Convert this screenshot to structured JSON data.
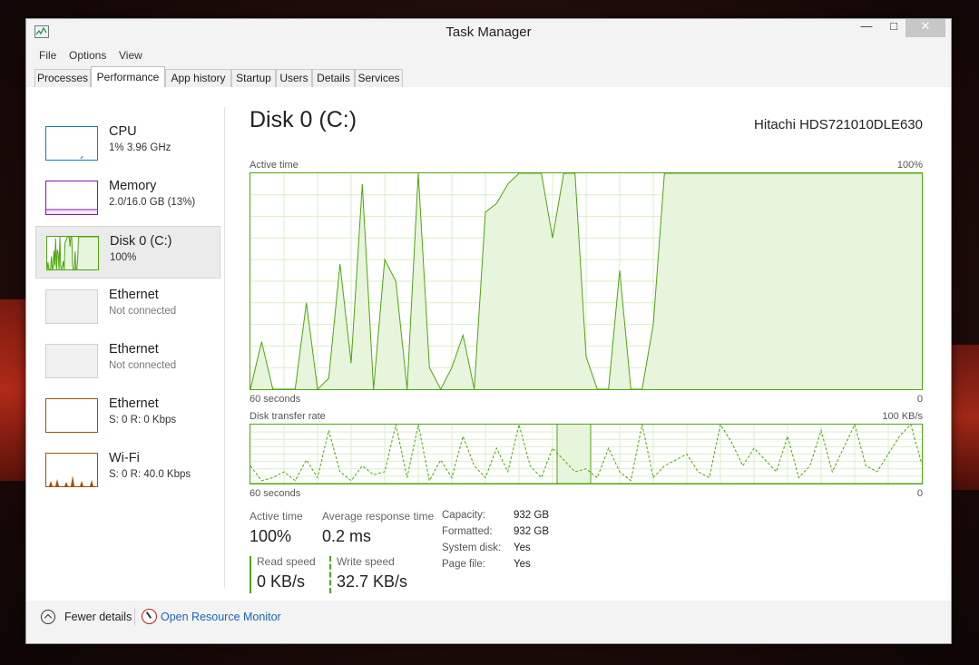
{
  "window": {
    "title": "Task Manager",
    "minimize": "—",
    "maximize": "□",
    "close": "✕"
  },
  "menu": [
    "File",
    "Options",
    "View"
  ],
  "tabs": [
    "Processes",
    "Performance",
    "App history",
    "Startup",
    "Users",
    "Details",
    "Services"
  ],
  "active_tab": "Performance",
  "sidebar": {
    "items": [
      {
        "name": "CPU",
        "sub": "1% 3.96 GHz",
        "kind": "cpu",
        "color": "#117dbb"
      },
      {
        "name": "Memory",
        "sub": "2.0/16.0 GB (13%)",
        "kind": "mem",
        "color": "#8b12ae"
      },
      {
        "name": "Disk 0 (C:)",
        "sub": "100%",
        "kind": "disk",
        "color": "#4da60c",
        "selected": true
      },
      {
        "name": "Ethernet",
        "sub": "Not connected",
        "kind": "eth-off"
      },
      {
        "name": "Ethernet",
        "sub": "Not connected",
        "kind": "eth-off"
      },
      {
        "name": "Ethernet",
        "sub": "S: 0  R: 0 Kbps",
        "kind": "eth",
        "color": "#a74f01"
      },
      {
        "name": "Wi-Fi",
        "sub": "S: 0  R: 40.0 Kbps",
        "kind": "eth",
        "color": "#a74f01"
      }
    ]
  },
  "main": {
    "title": "Disk 0 (C:)",
    "model": "Hitachi HDS721010DLE630",
    "active_chart": {
      "label": "Active time",
      "max_label": "100%",
      "x_left": "60 seconds",
      "x_right": "0",
      "color": "#4da60c"
    },
    "transfer_chart": {
      "label": "Disk transfer rate",
      "max_label": "100 KB/s",
      "x_left": "60 seconds",
      "x_right": "0"
    },
    "stats": {
      "active_time_label": "Active time",
      "active_time_value": "100%",
      "avg_response_label": "Average response time",
      "avg_response_value": "0.2 ms",
      "read_label": "Read speed",
      "read_value": "0 KB/s",
      "write_label": "Write speed",
      "write_value": "32.7 KB/s"
    },
    "properties": [
      {
        "key": "Capacity:",
        "value": "932 GB"
      },
      {
        "key": "Formatted:",
        "value": "932 GB"
      },
      {
        "key": "System disk:",
        "value": "Yes"
      },
      {
        "key": "Page file:",
        "value": "Yes"
      }
    ]
  },
  "footer": {
    "fewer_details": "Fewer details",
    "open_resource_monitor": "Open Resource Monitor"
  },
  "chart_data": [
    {
      "type": "area",
      "title": "Active time",
      "ylabel": "Active time",
      "ylim": [
        0,
        100
      ],
      "x": [
        60,
        59,
        58,
        57,
        56,
        55,
        54,
        53,
        52,
        51,
        50,
        49,
        48,
        47,
        46,
        45,
        44,
        43,
        42,
        41,
        40,
        39,
        38,
        37,
        36,
        35,
        34,
        33,
        32,
        31,
        30,
        29,
        28,
        27,
        26,
        25,
        24,
        23,
        22,
        21,
        20,
        19,
        18,
        17,
        16,
        15,
        14,
        13,
        12,
        11,
        10,
        9,
        8,
        7,
        6,
        5,
        4,
        3,
        2,
        1,
        0
      ],
      "values": [
        0,
        22,
        0,
        0,
        0,
        40,
        0,
        5,
        58,
        12,
        95,
        0,
        60,
        50,
        0,
        100,
        10,
        0,
        10,
        25,
        0,
        82,
        86,
        95,
        100,
        100,
        100,
        70,
        100,
        100,
        15,
        0,
        0,
        55,
        0,
        0,
        30,
        100,
        100,
        100,
        100,
        100,
        100,
        100,
        100,
        100,
        100,
        100,
        100,
        100,
        100,
        100,
        100,
        100,
        100,
        100,
        100,
        100,
        100,
        100,
        100
      ]
    },
    {
      "type": "line",
      "title": "Disk transfer rate",
      "ylabel": "Disk transfer rate",
      "ylim": [
        0,
        100
      ],
      "x": [
        60,
        59,
        58,
        57,
        56,
        55,
        54,
        53,
        52,
        51,
        50,
        49,
        48,
        47,
        46,
        45,
        44,
        43,
        42,
        41,
        40,
        39,
        38,
        37,
        36,
        35,
        34,
        33,
        32,
        31,
        30,
        29,
        28,
        27,
        26,
        25,
        24,
        23,
        22,
        21,
        20,
        19,
        18,
        17,
        16,
        15,
        14,
        13,
        12,
        11,
        10,
        9,
        8,
        7,
        6,
        5,
        4,
        3,
        2,
        1,
        0
      ],
      "series": [
        {
          "name": "Read speed",
          "values": [
            0,
            0,
            0,
            0,
            0,
            0,
            0,
            0,
            0,
            0,
            0,
            0,
            0,
            0,
            0,
            0,
            0,
            0,
            0,
            0,
            0,
            0,
            0,
            0,
            0,
            0,
            0,
            0,
            0,
            0,
            0,
            0,
            0,
            0,
            0,
            0,
            0,
            0,
            0,
            0,
            0,
            0,
            0,
            0,
            0,
            0,
            0,
            0,
            0,
            0,
            0,
            0,
            0,
            0,
            0,
            0,
            0,
            0,
            0,
            0,
            0
          ]
        },
        {
          "name": "Write speed",
          "values": [
            30,
            5,
            10,
            20,
            5,
            40,
            10,
            90,
            20,
            5,
            30,
            15,
            20,
            100,
            10,
            100,
            5,
            40,
            10,
            80,
            30,
            10,
            60,
            20,
            100,
            30,
            10,
            60,
            40,
            20,
            25,
            10,
            60,
            20,
            5,
            100,
            10,
            30,
            40,
            50,
            20,
            10,
            100,
            70,
            30,
            60,
            40,
            20,
            80,
            10,
            30,
            90,
            20,
            60,
            100,
            30,
            20,
            50,
            80,
            100,
            33
          ]
        }
      ]
    }
  ]
}
